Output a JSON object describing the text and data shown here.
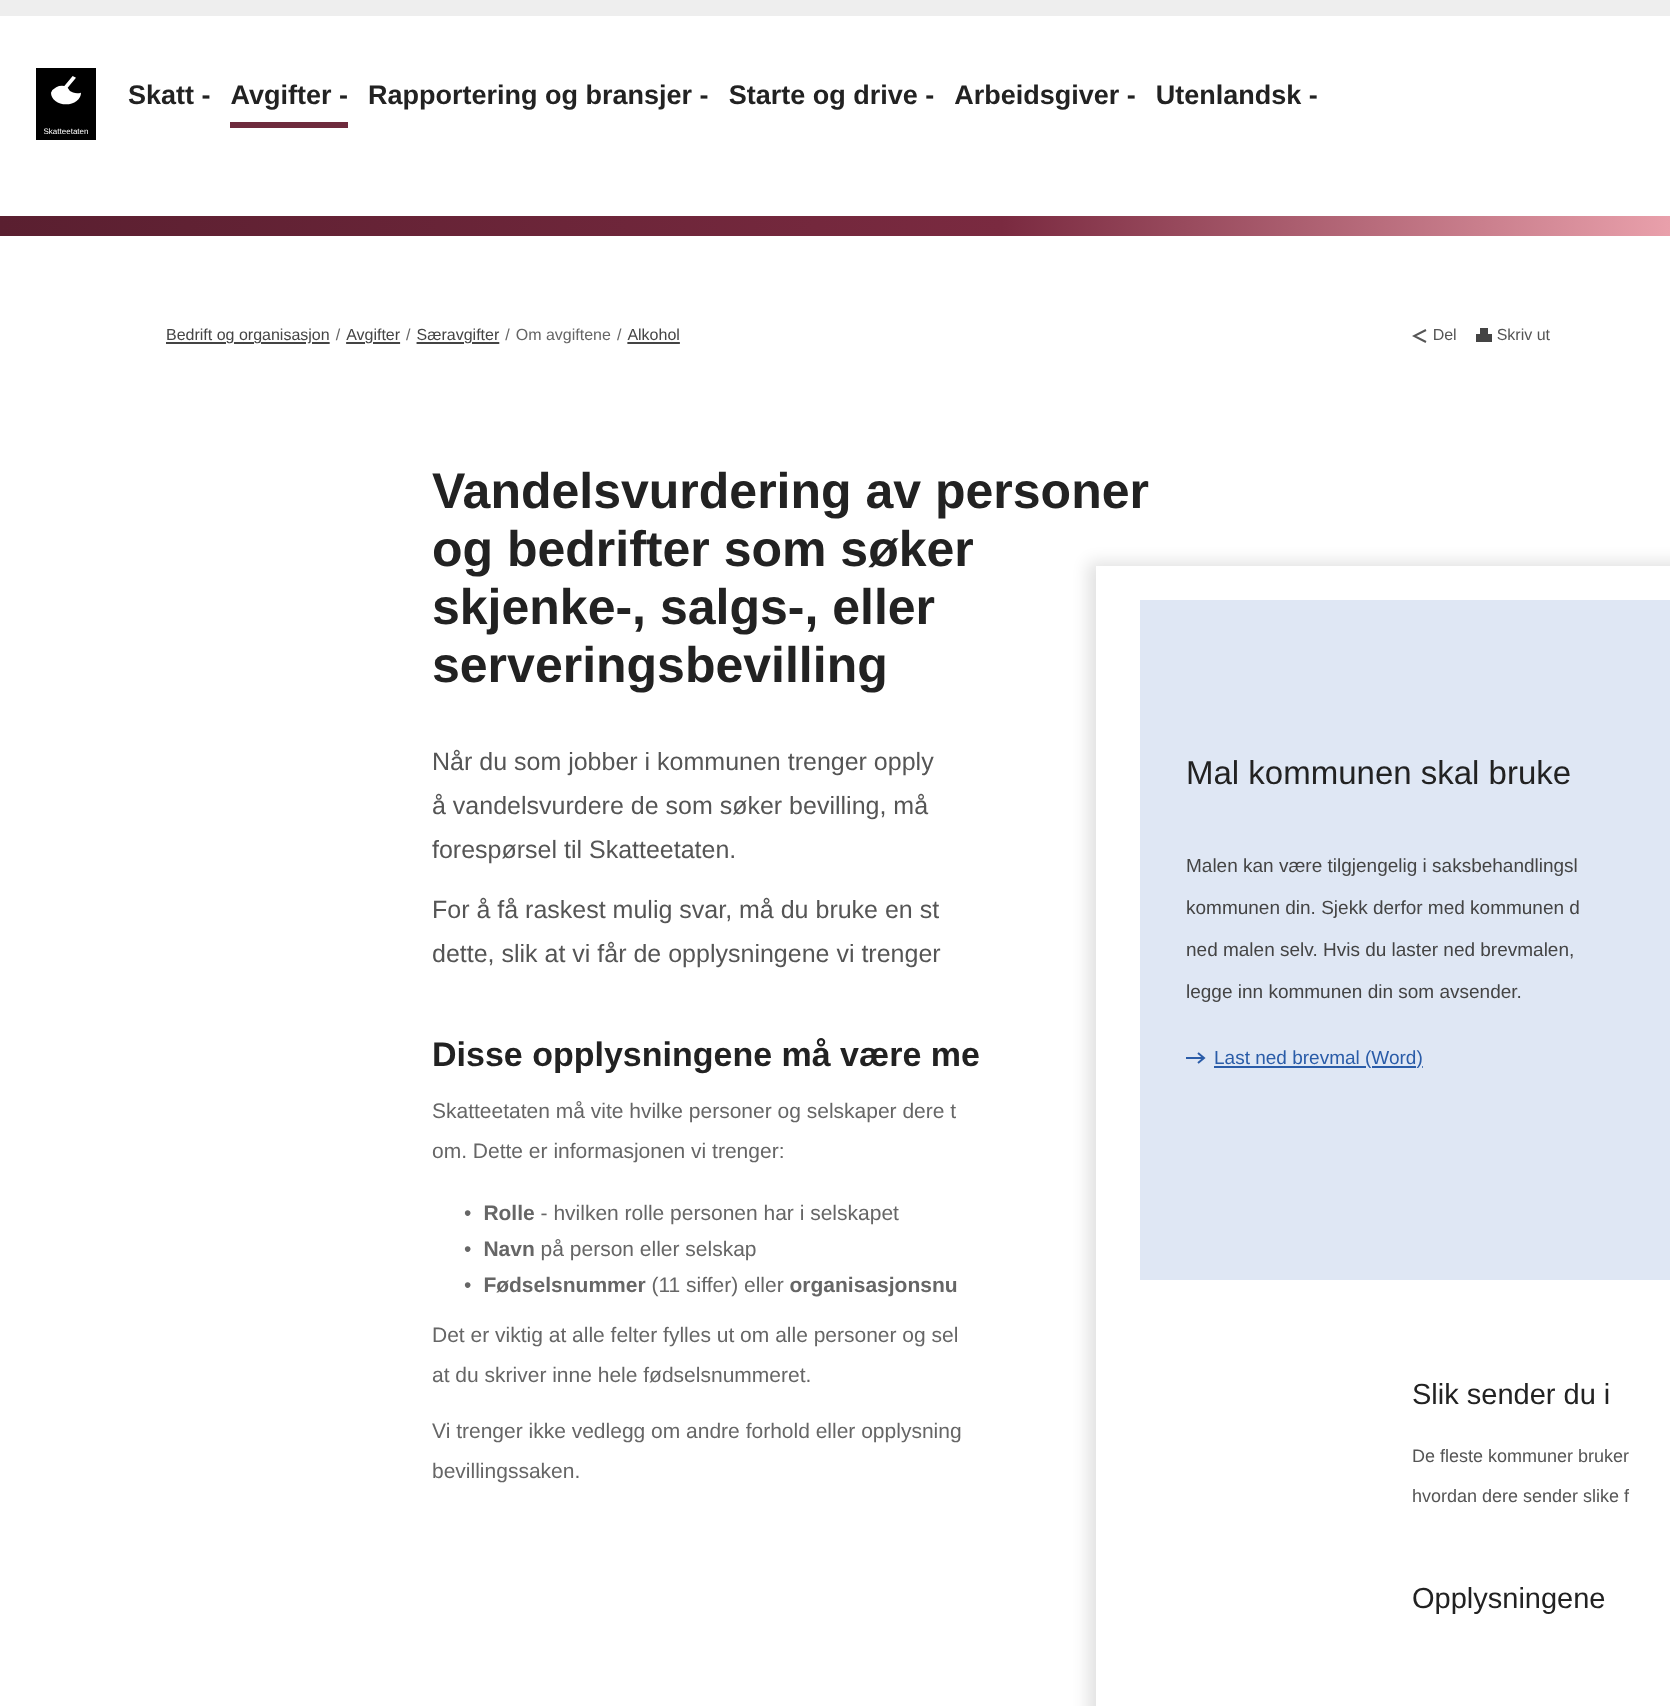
{
  "logo": {
    "caption": "Skatteetaten"
  },
  "nav": [
    {
      "label": "Skatt -",
      "selected": false
    },
    {
      "label": "Avgifter -",
      "selected": true
    },
    {
      "label": "Rapportering og bransjer -",
      "selected": false
    },
    {
      "label": "Starte og drive -",
      "selected": false
    },
    {
      "label": "Arbeidsgiver -",
      "selected": false
    },
    {
      "label": "Utenlandsk -",
      "selected": false
    }
  ],
  "breadcrumb": {
    "separator": "/",
    "items": [
      {
        "label": "Bedrift og organisasjon",
        "link": true
      },
      {
        "label": "Avgifter",
        "link": true
      },
      {
        "label": "Særavgifter",
        "link": true
      },
      {
        "label": "Om avgiftene",
        "link": false
      },
      {
        "label": "Alkohol",
        "link": true
      }
    ]
  },
  "actions": [
    {
      "kind": "share",
      "label": "Del"
    },
    {
      "kind": "print",
      "label": "Skriv ut"
    }
  ],
  "title_lines": [
    "Vandelsvurdering av personer",
    "og bedrifter som søker",
    "skjenke-, salgs-, eller",
    "serveringsbevilling"
  ],
  "intro": [
    [
      "Når du som jobber i kommunen trenger opply",
      "å vandelsvurdere de som søker bevilling, må",
      "forespørsel til Skatteetaten."
    ],
    [
      "For å få raskest mulig svar, må du bruke en st",
      "dette, slik at vi får de opplysningene vi trenger"
    ]
  ],
  "section": {
    "heading": "Disse opplysningene må være me",
    "lead": [
      "Skatteetaten må vite hvilke personer og selskaper dere t",
      "om. Dette er informasjonen vi trenger:"
    ],
    "marker": "•",
    "bullets": [
      "**Rolle** - hvilken rolle personen har i selskapet",
      "**Navn** på person eller selskap",
      "**Fødselsnummer** (11 siffer) eller **organisasjonsnu**"
    ],
    "after": [
      [
        "Det er viktig at alle felter fylles ut om alle personer og sel",
        "at du skriver inne hele fødselsnummeret."
      ],
      [
        "Vi trenger ikke vedlegg om andre forhold eller opplysning",
        "bevillingssaken."
      ]
    ]
  },
  "overlay": {
    "box": {
      "heading": "Mal kommunen skal bruke",
      "text": [
        "Malen kan være tilgjengelig i saksbehandlingsl",
        "kommunen din. Sjekk derfor med kommunen d",
        "ned malen selv. Hvis du laster ned brevmalen,",
        "legge inn kommunen din som avsender."
      ],
      "link": "Last ned brevmal (Word)"
    },
    "sections": [
      {
        "heading": "Slik sender du i",
        "text": [
          "De fleste kommuner bruker",
          "hvordan dere sender slike f"
        ]
      },
      {
        "heading": "Opplysningene"
      }
    ]
  }
}
